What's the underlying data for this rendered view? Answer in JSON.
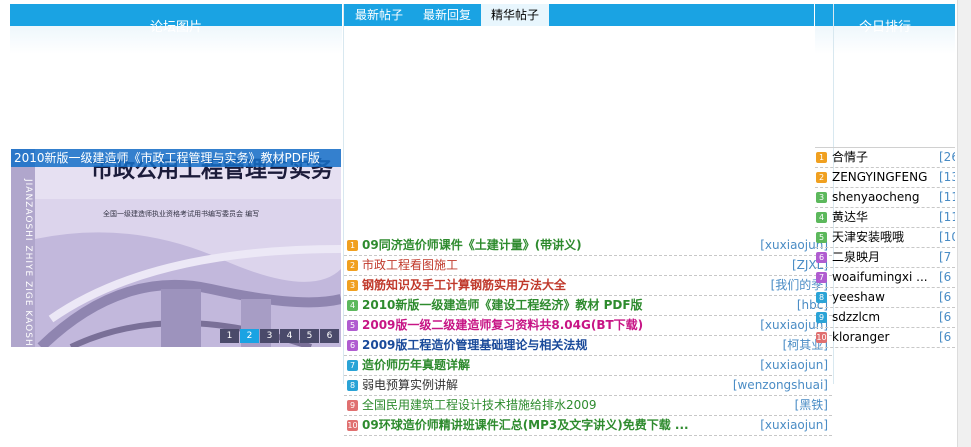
{
  "header": {
    "left_title": "论坛图片",
    "right_title": "今日排行",
    "tabs": [
      {
        "label": "最新帖子",
        "active": false
      },
      {
        "label": "最新回复",
        "active": false
      },
      {
        "label": "精华帖子",
        "active": true
      }
    ]
  },
  "slideshow": {
    "caption": "2010新版一级建造师《市政工程管理与实务》教材PDF版",
    "image_title": "市政公用工程管理与实务",
    "image_subtitle": "全国一级建造师执业资格考试用书编写委员会  编写",
    "side_text": "JIANZAOSHI ZHIYE ZIGE KAOSHI",
    "numbers": [
      "1",
      "2",
      "3",
      "4",
      "5",
      "6"
    ],
    "active_index": 1
  },
  "posts": [
    {
      "idx": "1",
      "title": "09同济造价师课件《土建计量》(带讲义)",
      "author": "[xuxiaojun]",
      "color": "#2e8b2e",
      "badge": "#f0a020",
      "bold": true
    },
    {
      "idx": "2",
      "title": "市政工程看图施工",
      "author": "[ZJXL]",
      "color": "#c0392b",
      "badge": "#f0a020",
      "bold": false
    },
    {
      "idx": "3",
      "title": "钢筋知识及手工计算钢筋实用方法大全",
      "author": "[我们的季]",
      "color": "#c0392b",
      "badge": "#f0a020",
      "bold": true
    },
    {
      "idx": "4",
      "title": "2010新版一级建造师《建设工程经济》教材 PDF版",
      "author": "[hbc]",
      "color": "#2e8b2e",
      "badge": "#5cb85c",
      "bold": true
    },
    {
      "idx": "5",
      "title": "2009版一级二级建造师复习资料共8.04G(BT下载)",
      "author": "[xuxiaojun]",
      "color": "#c71585",
      "badge": "#b05cd0",
      "bold": true
    },
    {
      "idx": "6",
      "title": "2009版工程造价管理基础理论与相关法规",
      "author": "[柯其业]",
      "color": "#1a4a9a",
      "badge": "#b05cd0",
      "bold": true
    },
    {
      "idx": "7",
      "title": "造价师历年真题详解",
      "author": "[xuxiaojun]",
      "color": "#2e8b2e",
      "badge": "#2aa3d6",
      "bold": true
    },
    {
      "idx": "8",
      "title": "弱电预算实例讲解",
      "author": "[wenzongshuai]",
      "color": "#333333",
      "badge": "#2aa3d6",
      "bold": false
    },
    {
      "idx": "9",
      "title": "全国民用建筑工程设计技术措施给排水2009",
      "author": "[黑铁]",
      "color": "#2e8b2e",
      "badge": "#e07070",
      "bold": false
    },
    {
      "idx": "10",
      "title": "09环球造价师精讲班课件汇总(MP3及文字讲义)免费下载 ...",
      "author": "[xuxiaojun]",
      "color": "#2e8b2e",
      "badge": "#e07070",
      "bold": true
    }
  ],
  "ranking": [
    {
      "idx": "1",
      "name": "合情子",
      "count": "[26",
      "badge": "#f0a020"
    },
    {
      "idx": "2",
      "name": "ZENGYINGFENG",
      "count": "[13",
      "badge": "#f0a020"
    },
    {
      "idx": "3",
      "name": "shenyaocheng",
      "count": "[11",
      "badge": "#5cb85c"
    },
    {
      "idx": "4",
      "name": "黄达华",
      "count": "[11",
      "badge": "#5cb85c"
    },
    {
      "idx": "5",
      "name": "天津安装哦哦",
      "count": "[10",
      "badge": "#5cb85c"
    },
    {
      "idx": "6",
      "name": "二泉映月",
      "count": "[7",
      "badge": "#b05cd0"
    },
    {
      "idx": "7",
      "name": "woaifumingxi ...",
      "count": "[6",
      "badge": "#b05cd0"
    },
    {
      "idx": "8",
      "name": "yeeshaw",
      "count": "[6",
      "badge": "#2aa3d6"
    },
    {
      "idx": "9",
      "name": "sdzzlcm",
      "count": "[6",
      "badge": "#2aa3d6"
    },
    {
      "idx": "10",
      "name": "kloranger",
      "count": "[6",
      "badge": "#e07070"
    }
  ]
}
